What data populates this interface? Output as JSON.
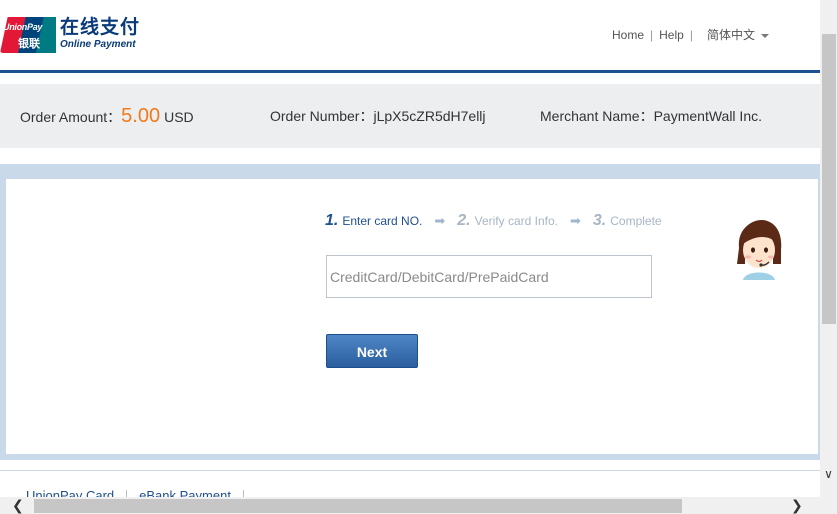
{
  "header": {
    "logo": {
      "badge_top": "UnionPay",
      "badge_bottom": "银联",
      "title_cn": "在线支付",
      "title_en": "Online Payment"
    },
    "nav": {
      "home": "Home",
      "help": "Help",
      "language": "简体中文"
    }
  },
  "order": {
    "amount_label": "Order Amount：",
    "amount_value": "5.00",
    "currency": "USD",
    "number_label": "Order Number：",
    "number_value": "jLpX5cZR5dH7ellj",
    "merchant_label": "Merchant Name：",
    "merchant_value": "PaymentWall Inc."
  },
  "steps": [
    {
      "num": "1.",
      "label": "Enter card NO."
    },
    {
      "num": "2.",
      "label": "Verify card Info."
    },
    {
      "num": "3.",
      "label": "Complete"
    }
  ],
  "card_input": {
    "placeholder": "CreditCard/DebitCard/PrePaidCard",
    "value": ""
  },
  "next_button": "Next",
  "bottom_tabs": [
    "UnionPay Card",
    "eBank Payment"
  ],
  "colors": {
    "brand_blue": "#1e4f91",
    "amount_orange": "#f07a19",
    "frame_blue": "#c9d9ea"
  }
}
